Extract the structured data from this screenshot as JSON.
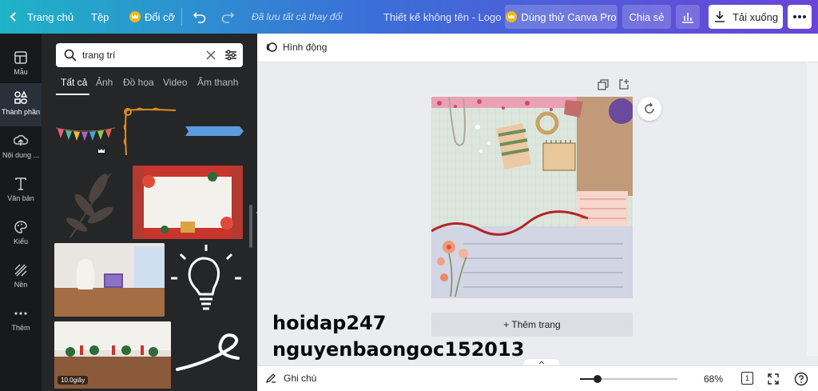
{
  "topbar": {
    "back_label": "Trang chủ",
    "file_label": "Tệp",
    "resize_label": "Đổi cỡ",
    "save_status": "Đã lưu tất cả thay đổi",
    "design_title": "Thiết kế không tên - Logo",
    "pro_label": "Dùng thử Canva Pro",
    "share_label": "Chia sẻ",
    "download_label": "Tải xuống"
  },
  "rail": {
    "items": [
      {
        "label": "Mẫu",
        "icon": "template-icon"
      },
      {
        "label": "Thành phần",
        "icon": "elements-icon"
      },
      {
        "label": "Nội dung ...",
        "icon": "upload-icon"
      },
      {
        "label": "Văn bản",
        "icon": "text-icon"
      },
      {
        "label": "Kiểu",
        "icon": "palette-icon"
      },
      {
        "label": "Nền",
        "icon": "background-icon"
      },
      {
        "label": "Thêm",
        "icon": "more-icon"
      }
    ]
  },
  "panel": {
    "search_value": "trang trí",
    "tabs": [
      "Tất cả",
      "Ảnh",
      "Đồ họa",
      "Video",
      "Âm thanh"
    ],
    "video_duration": "10.0giây"
  },
  "editor": {
    "animate_label": "Hình động",
    "add_page_label": "+ Thêm trang",
    "watermark_line1": "hoidap247",
    "watermark_line2": "nguyenbaongoc152013"
  },
  "bottombar": {
    "notes_label": "Ghi chú",
    "zoom_percent": "68%",
    "zoom_level": 0.18,
    "page_count": "1"
  },
  "colors": {
    "accent_gradient_start": "#1fb3c7",
    "accent_gradient_end": "#6a44d8",
    "panel_bg": "#252627",
    "rail_bg": "#18191b"
  }
}
